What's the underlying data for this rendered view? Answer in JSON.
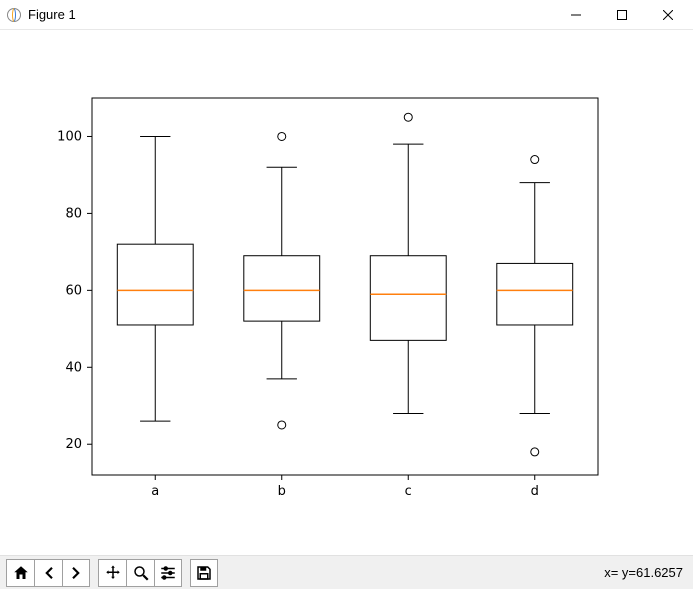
{
  "window": {
    "title": "Figure 1",
    "minimize_label": "Minimize",
    "maximize_label": "Maximize",
    "close_label": "Close"
  },
  "toolbar": {
    "home": "Home",
    "back": "Back",
    "forward": "Forward",
    "pan": "Pan",
    "zoom": "Zoom",
    "configure": "Configure subplots",
    "save": "Save",
    "coords": "x= y=61.6257"
  },
  "chart_data": {
    "type": "boxplot",
    "categories": [
      "a",
      "b",
      "c",
      "d"
    ],
    "series": [
      {
        "name": "a",
        "whisker_low": 26,
        "q1": 51,
        "median": 60,
        "q3": 72,
        "whisker_high": 100,
        "outliers": []
      },
      {
        "name": "b",
        "whisker_low": 37,
        "q1": 52,
        "median": 60,
        "q3": 69,
        "whisker_high": 92,
        "outliers": [
          100,
          25
        ]
      },
      {
        "name": "c",
        "whisker_low": 28,
        "q1": 47,
        "median": 59,
        "q3": 69,
        "whisker_high": 98,
        "outliers": [
          105
        ]
      },
      {
        "name": "d",
        "whisker_low": 28,
        "q1": 51,
        "median": 60,
        "q3": 67,
        "whisker_high": 88,
        "outliers": [
          94,
          18
        ]
      }
    ],
    "yticks": [
      20,
      40,
      60,
      80,
      100
    ],
    "ylim": [
      12,
      110
    ],
    "xlabel": "",
    "ylabel": "",
    "title": ""
  }
}
